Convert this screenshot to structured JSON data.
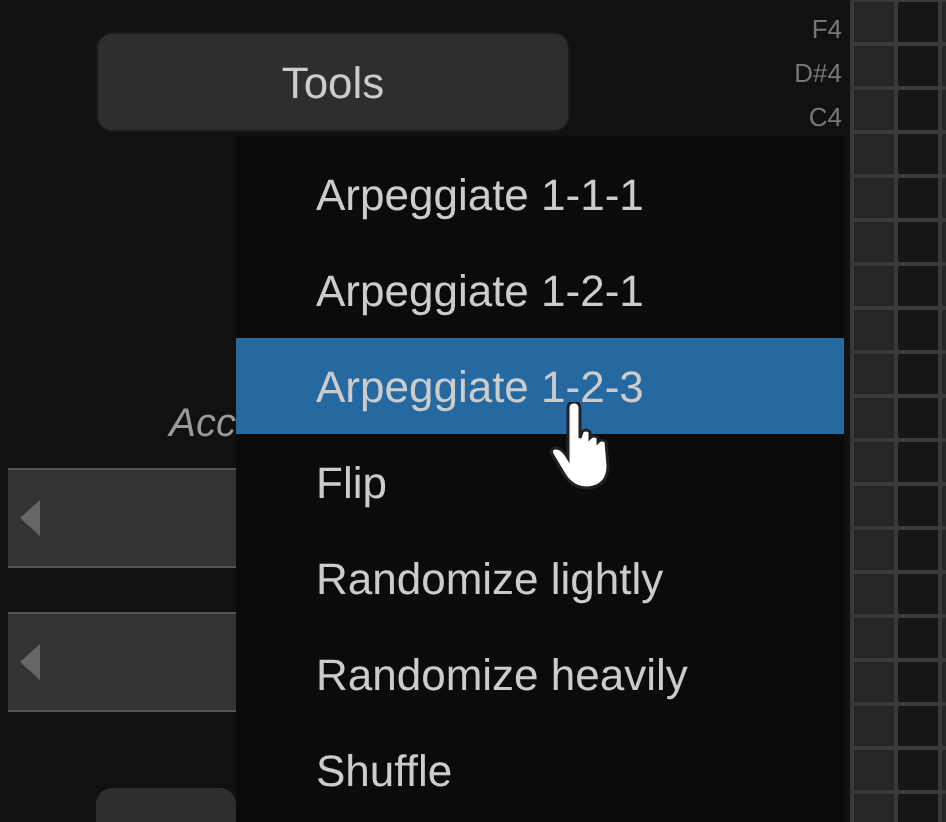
{
  "tools_button": {
    "label": "Tools"
  },
  "note_labels": [
    "F4",
    "D#4",
    "C4"
  ],
  "side_label": "Acc",
  "menu": {
    "items": [
      {
        "label": "Arpeggiate 1-1-1",
        "selected": false
      },
      {
        "label": "Arpeggiate 1-2-1",
        "selected": false
      },
      {
        "label": "Arpeggiate 1-2-3",
        "selected": true
      },
      {
        "label": "Flip",
        "selected": false
      },
      {
        "label": "Randomize lightly",
        "selected": false
      },
      {
        "label": "Randomize heavily",
        "selected": false
      },
      {
        "label": "Shuffle",
        "selected": false
      }
    ]
  }
}
